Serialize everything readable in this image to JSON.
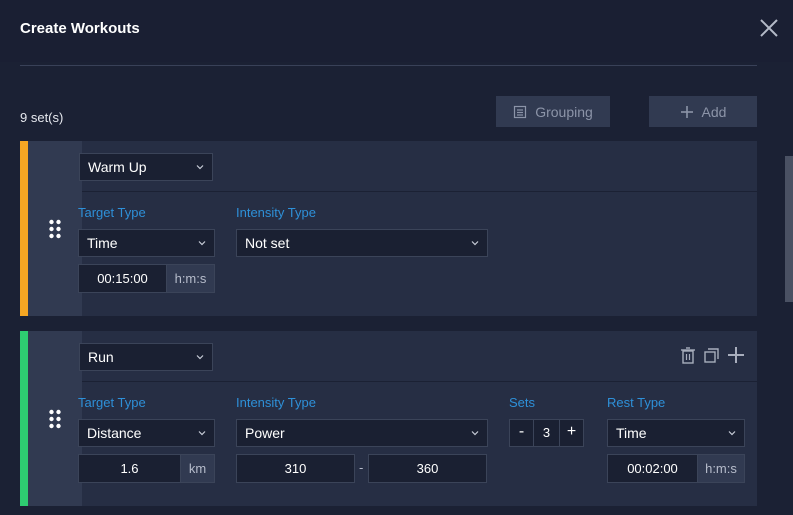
{
  "header": {
    "title": "Create Workouts"
  },
  "toolbar": {
    "set_count": "9 set(s)",
    "grouping_label": "Grouping",
    "add_label": "Add"
  },
  "colors": {
    "warmup_stripe": "#f5a623",
    "run_stripe": "#2ecc71",
    "label_blue": "#2e90d8"
  },
  "warmup": {
    "step": "Warm Up",
    "target_type_label": "Target Type",
    "target_type": "Time",
    "intensity_type_label": "Intensity Type",
    "intensity_type": "Not set",
    "duration": "00:15:00",
    "duration_unit": "h:m:s"
  },
  "run": {
    "step": "Run",
    "target_type_label": "Target Type",
    "target_type": "Distance",
    "distance": "1.6",
    "distance_unit": "km",
    "intensity_type_label": "Intensity Type",
    "intensity_type": "Power",
    "intensity_low": "310",
    "intensity_separator": "-",
    "intensity_high": "360",
    "sets_label": "Sets",
    "sets_minus": "-",
    "sets_value": "3",
    "sets_plus": "+",
    "rest_type_label": "Rest Type",
    "rest_type": "Time",
    "rest_duration": "00:02:00",
    "rest_unit": "h:m:s"
  }
}
